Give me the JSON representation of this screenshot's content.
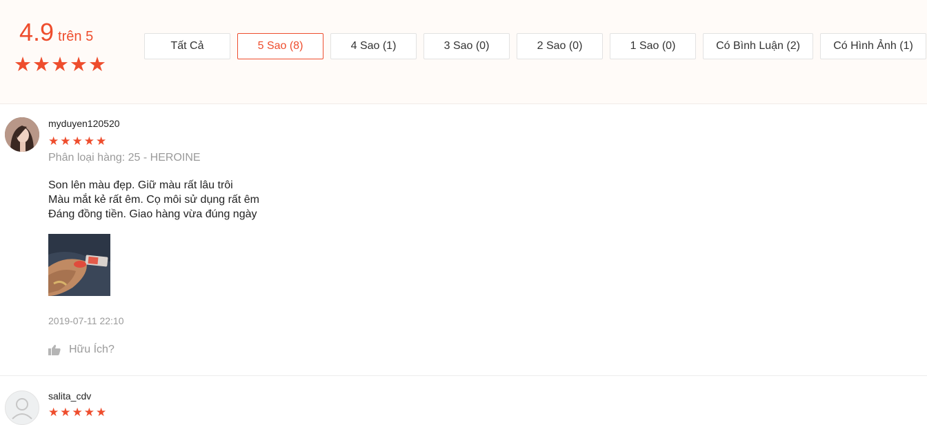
{
  "rating_overview": {
    "score": "4.9",
    "score_suffix": "trên 5",
    "stars": 5
  },
  "filters": [
    {
      "label": "Tất Cả",
      "active": false
    },
    {
      "label": "5 Sao (8)",
      "active": true
    },
    {
      "label": "4 Sao (1)",
      "active": false
    },
    {
      "label": "3 Sao (0)",
      "active": false
    },
    {
      "label": "2 Sao (0)",
      "active": false
    },
    {
      "label": "1 Sao (0)",
      "active": false
    },
    {
      "label": "Có Bình Luận (2)",
      "active": false
    },
    {
      "label": "Có Hình Ảnh (1)",
      "active": false
    }
  ],
  "reviews": [
    {
      "username": "myduyen120520",
      "stars": 5,
      "variation": "Phân loại hàng: 25 - HEROINE",
      "comment_lines": [
        "Son lên màu đẹp. Giữ màu rất lâu trôi",
        "Màu mắt kẻ rất êm. Cọ môi sử dụng rất êm",
        "Đáng đồng tiền. Giao hàng vừa đúng ngày"
      ],
      "timestamp": "2019-07-11 22:10",
      "helpful_label": "Hữu Ích?"
    },
    {
      "username": "salita_cdv",
      "stars": 5
    }
  ],
  "colors": {
    "accent": "#ee4d2d",
    "muted": "#9a9a9a"
  },
  "icons": {
    "star": "star-icon",
    "thumb": "thumbs-up-icon",
    "avatar_default": "user-icon"
  }
}
